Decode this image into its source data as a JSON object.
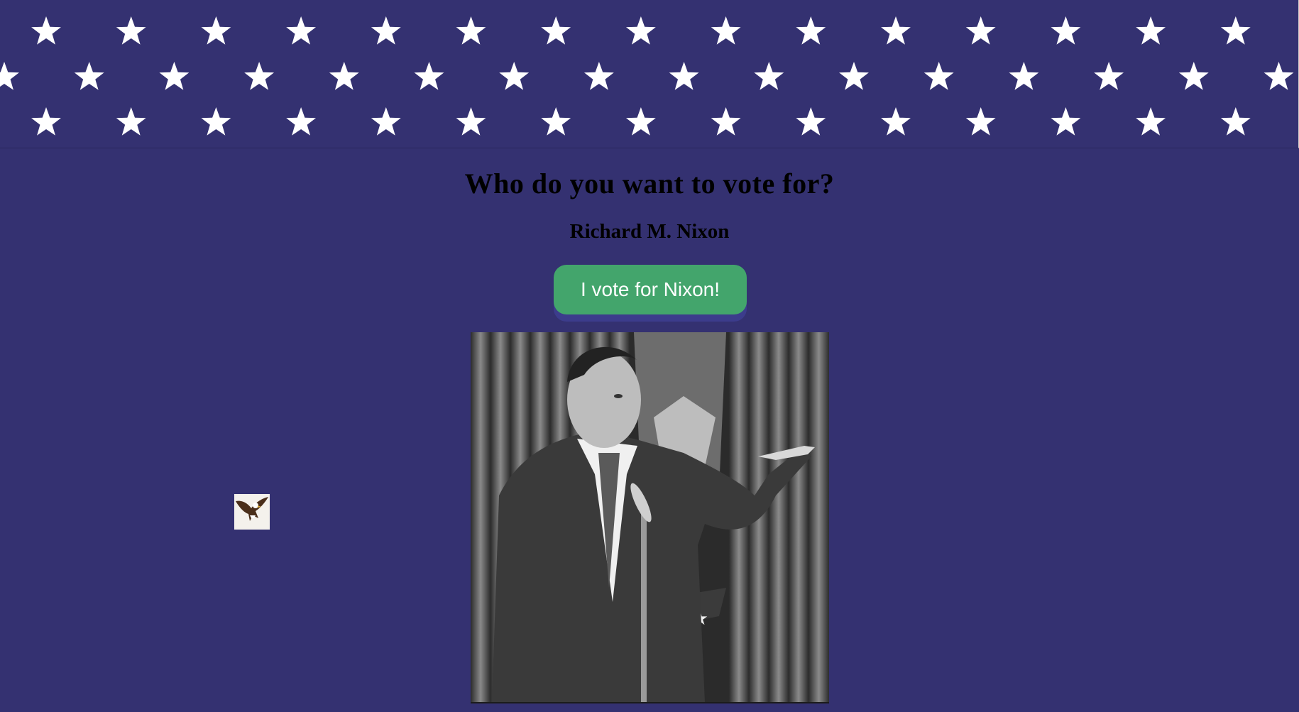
{
  "banner": {
    "star_rows": 3,
    "star_color": "#ffffff",
    "background": "#343171",
    "icon": "stars-banner"
  },
  "main": {
    "heading": "Who do you want to vote for?",
    "candidate_name": "Richard M. Nixon",
    "vote_button_label": "I vote for Nixon!"
  },
  "images": {
    "candidate_photo": "nixon-photo",
    "eagle": "eagle-icon"
  },
  "colors": {
    "page_background": "#343171",
    "button_background": "#43a56c",
    "button_text": "#ffffff"
  }
}
